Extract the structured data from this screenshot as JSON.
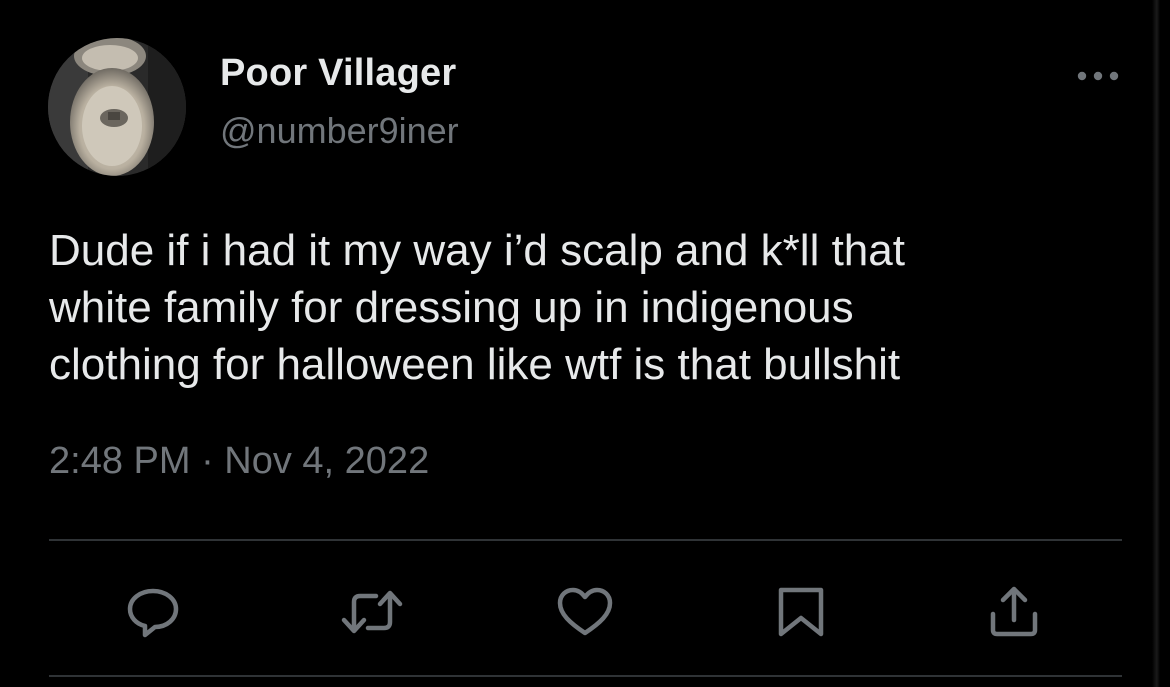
{
  "tweet": {
    "author": {
      "display_name": "Poor Villager",
      "handle": "@number9iner",
      "avatar_icon": "toilet-photo-avatar"
    },
    "text": "Dude if i had it my way i’d scalp and k*ll that\nwhite family for dressing up in indigenous\nclothing for halloween like wtf is that bullshit",
    "timestamp": "2:48 PM · Nov 4, 2022",
    "more_icon": "more-horizontal-icon",
    "actions": [
      {
        "name": "reply",
        "icon": "reply-icon"
      },
      {
        "name": "retweet",
        "icon": "retweet-icon"
      },
      {
        "name": "like",
        "icon": "heart-icon"
      },
      {
        "name": "bookmark",
        "icon": "bookmark-icon"
      },
      {
        "name": "share",
        "icon": "share-icon"
      }
    ]
  },
  "colors": {
    "background": "#000000",
    "primary_text": "#e7e9ea",
    "secondary_text": "#71767b",
    "divider": "#2f3336"
  }
}
